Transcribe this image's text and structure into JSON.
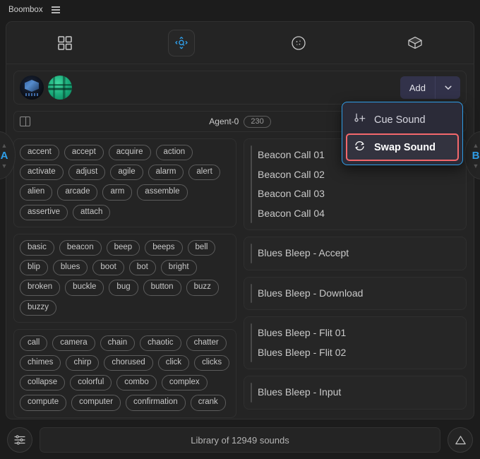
{
  "window": {
    "title": "Boombox",
    "menu_icon": "hamburger-menu-icon"
  },
  "modebar": {
    "buttons": [
      {
        "id": "grid",
        "icon": "grid-view-icon",
        "active": false
      },
      {
        "id": "explore",
        "icon": "search-navigate-icon",
        "active": true
      },
      {
        "id": "circle",
        "icon": "circle-dots-icon",
        "active": false
      },
      {
        "id": "cube",
        "icon": "cube-3d-icon",
        "active": false
      }
    ]
  },
  "avatar_row": {
    "avatars": [
      {
        "id": "avatar-1",
        "label": "Agent avatar 1"
      },
      {
        "id": "avatar-2",
        "label": "Agent avatar 2"
      }
    ],
    "add_label": "Add",
    "dropdown_icon": "chevron-down-icon"
  },
  "agent_row": {
    "panel_icon": "split-panel-icon",
    "name": "Agent-0",
    "badge": "230"
  },
  "side_handles": {
    "left": {
      "label": "A"
    },
    "right": {
      "label": "B"
    }
  },
  "context_menu": {
    "items": [
      {
        "label": "Cue Sound",
        "icon": "cue-marker-icon",
        "highlighted": false
      },
      {
        "label": "Swap Sound",
        "icon": "swap-arrows-icon",
        "highlighted": true
      }
    ]
  },
  "tag_groups": [
    {
      "id": "group-a",
      "tags": [
        "accent",
        "accept",
        "acquire",
        "action",
        "activate",
        "adjust",
        "agile",
        "alarm",
        "alert",
        "alien",
        "arcade",
        "arm",
        "assemble",
        "assertive",
        "attach"
      ]
    },
    {
      "id": "group-b",
      "tags": [
        "basic",
        "beacon",
        "beep",
        "beeps",
        "bell",
        "blip",
        "blues",
        "boot",
        "bot",
        "bright",
        "broken",
        "buckle",
        "bug",
        "button",
        "buzz",
        "buzzy"
      ]
    },
    {
      "id": "group-c",
      "tags": [
        "call",
        "camera",
        "chain",
        "chaotic",
        "chatter",
        "chimes",
        "chirp",
        "chorused",
        "click",
        "clicks",
        "collapse",
        "colorful",
        "combo",
        "complex",
        "compute",
        "computer",
        "confirmation",
        "crank"
      ]
    }
  ],
  "sound_groups": [
    {
      "id": "beacon-call",
      "items": [
        "Beacon Call 01",
        "Beacon Call 02",
        "Beacon Call 03",
        "Beacon Call 04"
      ]
    },
    {
      "id": "blues-accept",
      "items": [
        "Blues Bleep - Accept"
      ]
    },
    {
      "id": "blues-download",
      "items": [
        "Blues Bleep - Download"
      ]
    },
    {
      "id": "blues-flit",
      "items": [
        "Blues Bleep - Flit 01",
        "Blues Bleep - Flit 02"
      ]
    },
    {
      "id": "blues-input",
      "items": [
        "Blues Bleep - Input"
      ]
    }
  ],
  "bottom_bar": {
    "filter_icon": "sliders-mixer-icon",
    "library_label": "Library of 12949 sounds",
    "collapse_icon": "triangle-up-icon"
  },
  "colors": {
    "background": "#1c1c1c",
    "panel": "#242424",
    "accent_blue": "#2f9ee8",
    "highlight_red": "#f4686c",
    "add_button": "#32324a",
    "text_primary": "#cdcdcd"
  }
}
